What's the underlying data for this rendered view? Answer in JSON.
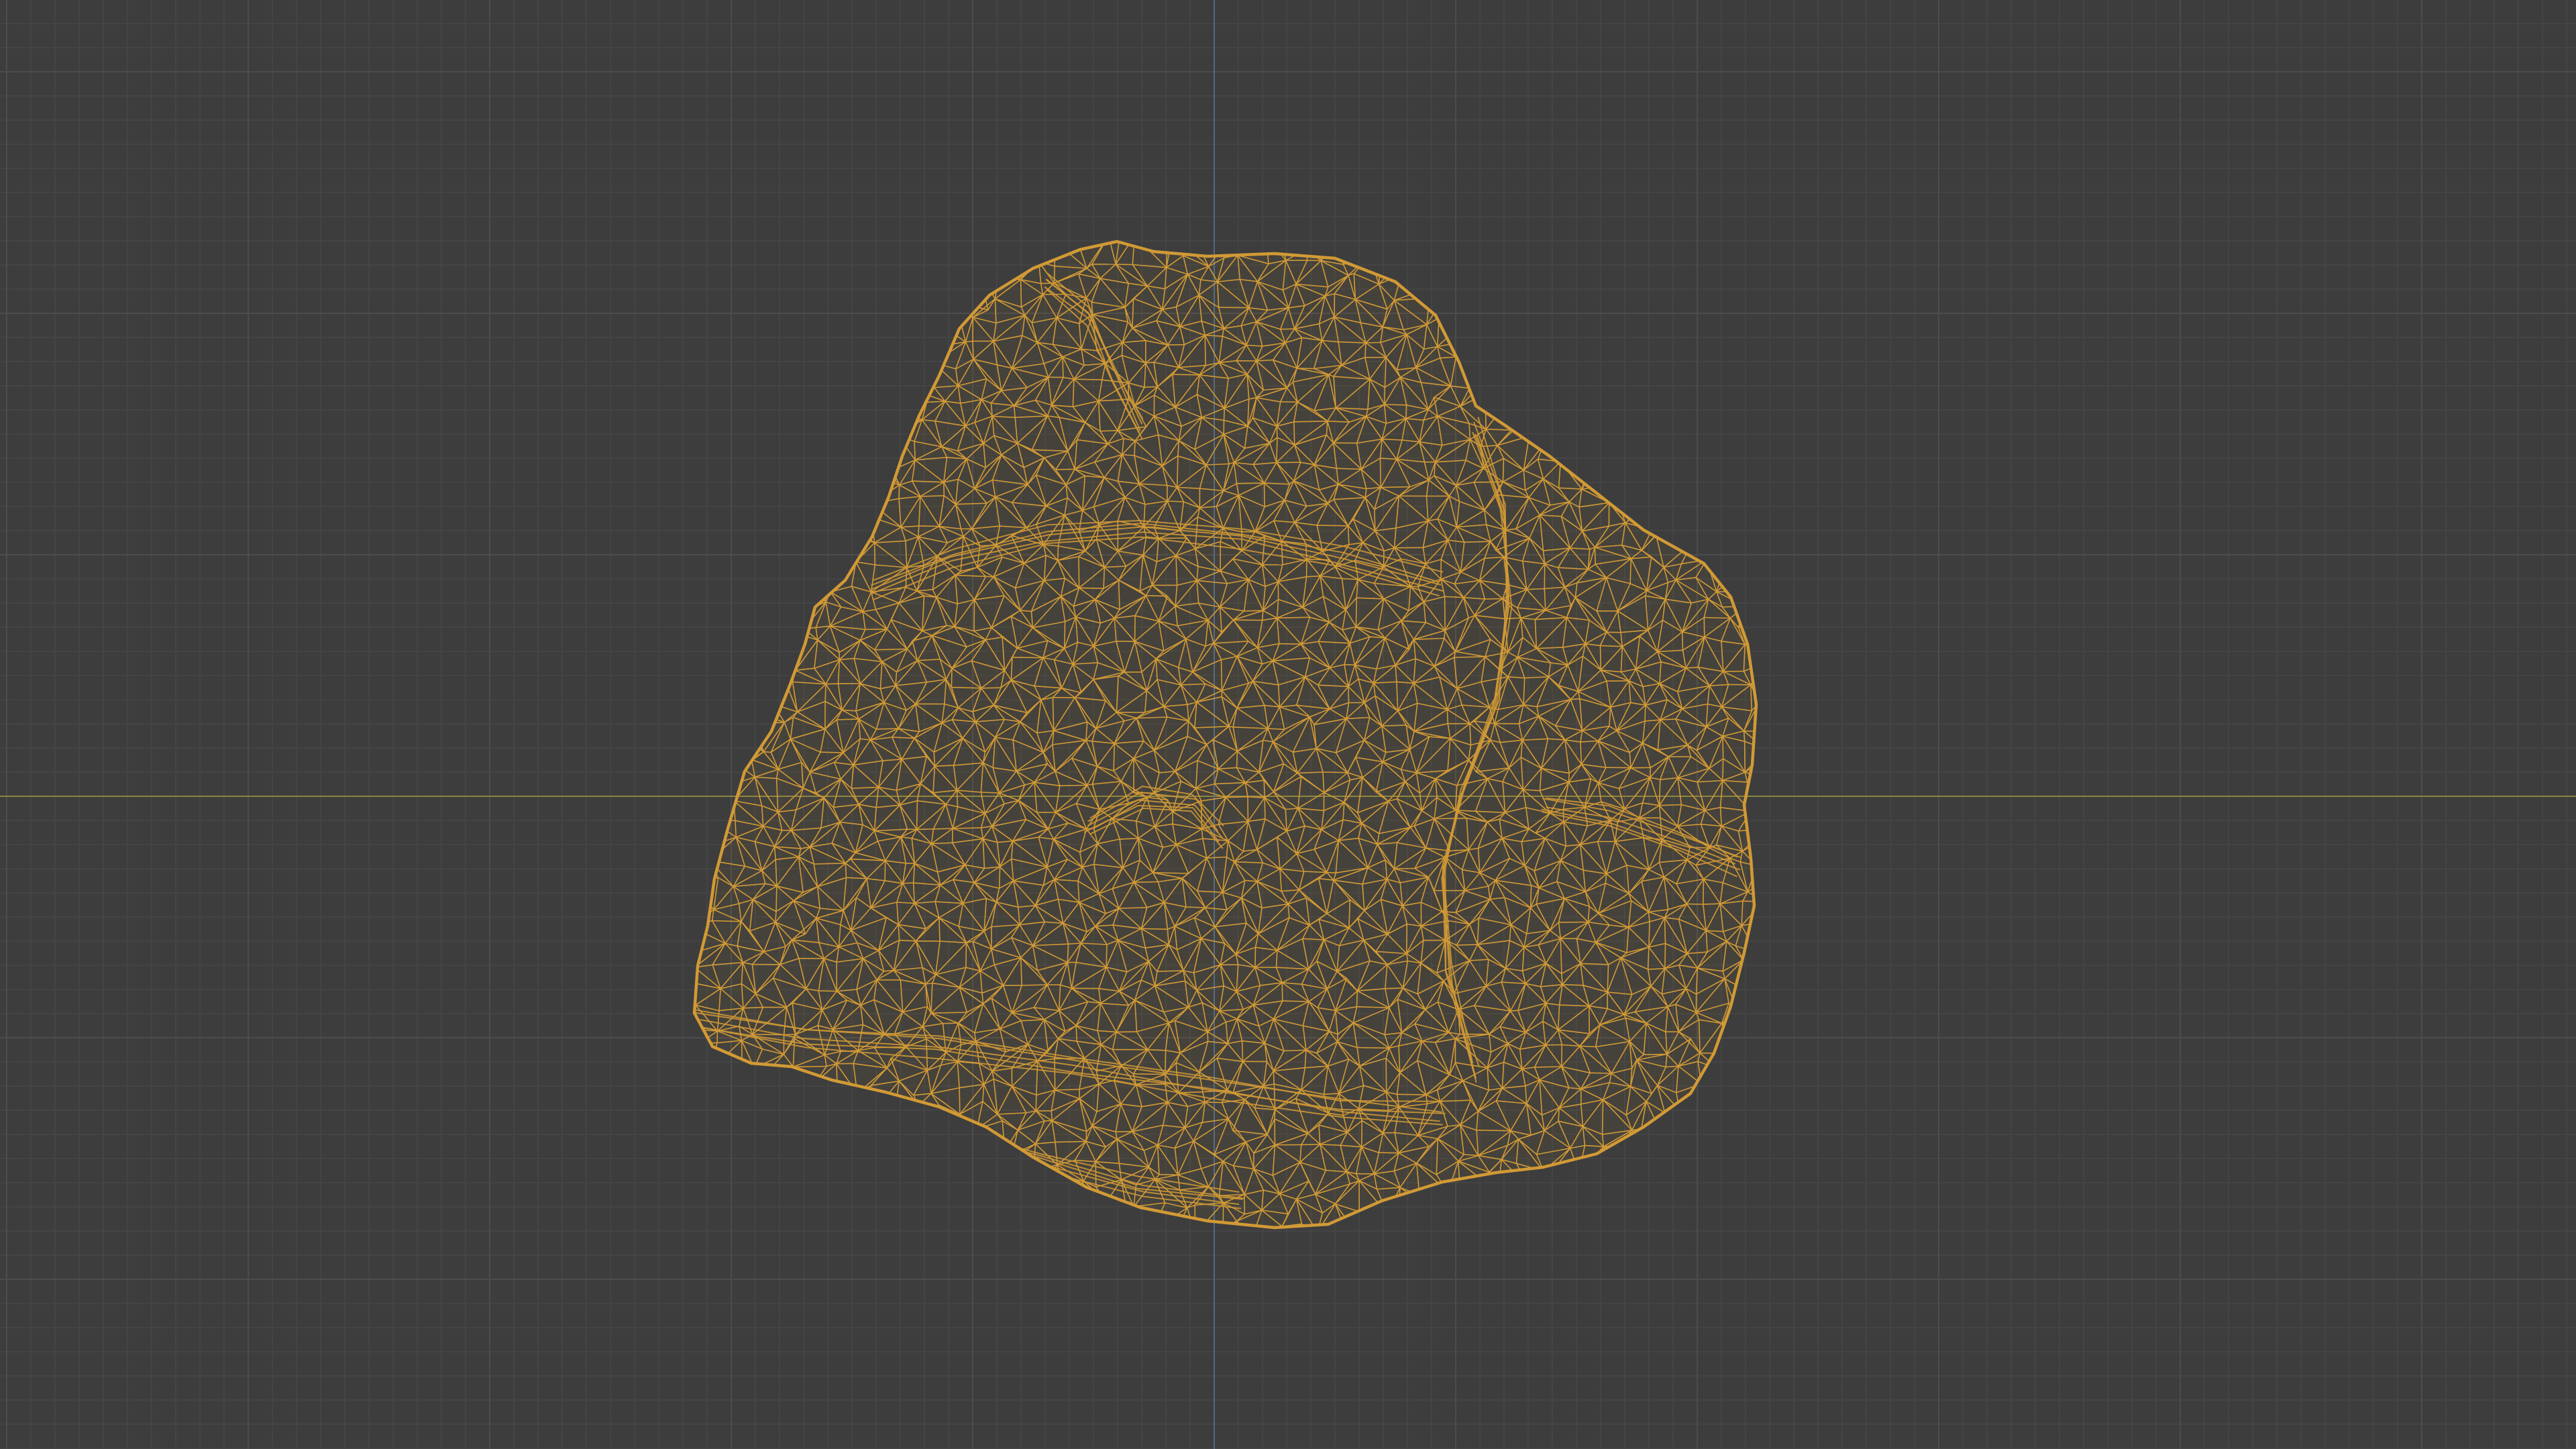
{
  "viewport": {
    "shading_mode": "wireframe",
    "background_color": "#3d3d3d",
    "grid_minor_color": "#464646",
    "grid_major_color": "#4c4c4c",
    "x_axis_color": "#8a8540",
    "y_axis_color": "#4f6a86",
    "object": {
      "kind": "irregular rock mesh",
      "wire_color": "#d29a35",
      "selected": true
    }
  }
}
